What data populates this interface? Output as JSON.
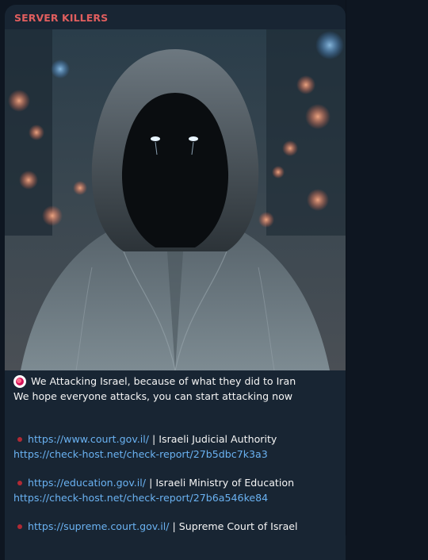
{
  "channel": {
    "name": "SERVER KILLERS"
  },
  "post": {
    "image_alt_icon": "hooded-figure-photo",
    "line1": "We Attacking Israel, because of what they did to Iran",
    "line2": "We hope everyone attacks, you can start attacking now",
    "targets": [
      {
        "url": "https://www.court.gov.il/",
        "separator": "|",
        "name": "Israeli Judicial Authority",
        "report": "https://check-host.net/check-report/27b5dbc7k3a3"
      },
      {
        "url": "https://education.gov.il/",
        "separator": "|",
        "name": "Israeli Ministry of Education",
        "report": "https://check-host.net/check-report/27b6a546ke84"
      },
      {
        "url": "https://supreme.court.gov.il/",
        "separator": "|",
        "name": "Supreme Court of Israel"
      }
    ]
  },
  "colors": {
    "sender": "#e05e5e",
    "link": "#6ab2f2",
    "bubble": "#182533",
    "background": "#0e1621"
  }
}
